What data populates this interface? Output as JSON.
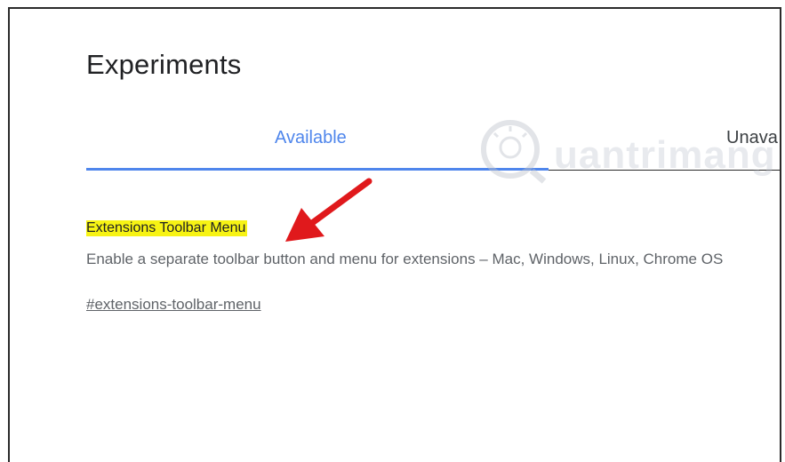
{
  "page": {
    "title": "Experiments"
  },
  "tabs": [
    {
      "label": "Available",
      "active": true
    },
    {
      "label": "Unava",
      "active": false
    }
  ],
  "watermark": {
    "text": "uantrimang"
  },
  "experiment": {
    "name": "Extensions Toolbar Menu",
    "description": "Enable a separate toolbar button and menu for extensions – Mac, Windows, Linux, Chrome OS",
    "link": "#extensions-toolbar-menu"
  },
  "colors": {
    "accent": "#4f86ec",
    "highlight": "#f7f314",
    "arrow": "#e0191c",
    "text": "#202124",
    "muted": "#5f6368"
  },
  "icons": {
    "annotation": "red-arrow-icon",
    "watermark": "lightbulb-icon"
  }
}
